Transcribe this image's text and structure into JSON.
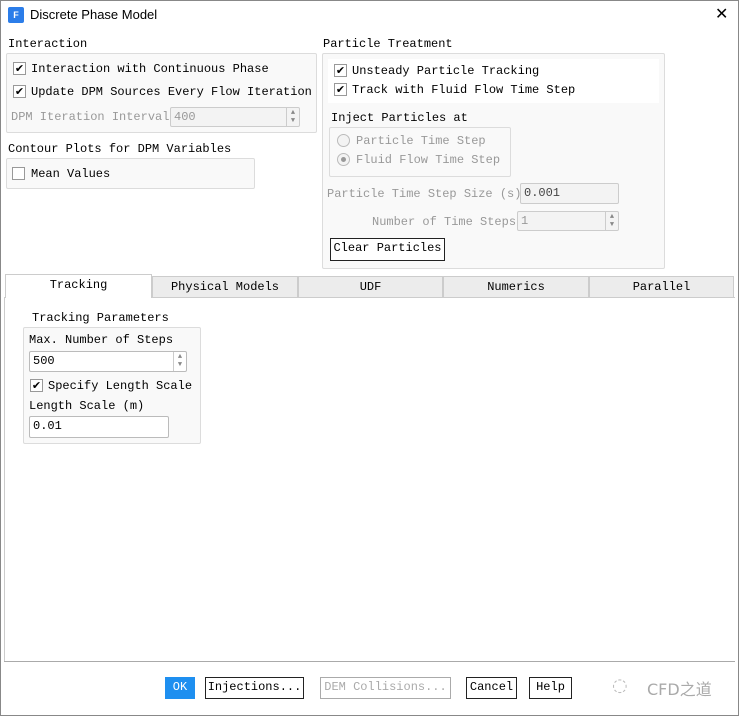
{
  "window": {
    "title": "Discrete Phase Model",
    "app_icon": "F",
    "close": "✕"
  },
  "interaction": {
    "label": "Interaction",
    "continuous_phase": {
      "label": "Interaction with Continuous Phase",
      "checked": true
    },
    "update_sources": {
      "label": "Update DPM Sources Every Flow Iteration",
      "checked": true
    },
    "iteration_interval": {
      "label": "DPM Iteration Interval",
      "value": "400"
    }
  },
  "contour": {
    "label": "Contour Plots for DPM Variables",
    "mean_values": {
      "label": "Mean Values",
      "checked": false
    }
  },
  "particle_treatment": {
    "label": "Particle Treatment",
    "unsteady": {
      "label": "Unsteady Particle Tracking",
      "checked": true
    },
    "track_fluid": {
      "label": "Track with Fluid Flow Time Step",
      "checked": true
    },
    "inject": {
      "label": "Inject Particles at",
      "options": [
        "Particle Time Step",
        "Fluid Flow Time Step"
      ],
      "selected": "Fluid Flow Time Step"
    },
    "time_step_size": {
      "label": "Particle Time Step Size (s)",
      "value": "0.001"
    },
    "num_time_steps": {
      "label": "Number of Time Steps",
      "value": "1"
    },
    "clear_button": "Clear Particles"
  },
  "tabs": [
    "Tracking",
    "Physical Models",
    "UDF",
    "Numerics",
    "Parallel"
  ],
  "active_tab": "Tracking",
  "tracking": {
    "label": "Tracking Parameters",
    "max_steps": {
      "label": "Max. Number of Steps",
      "value": "500"
    },
    "specify_length": {
      "label": "Specify Length Scale",
      "checked": true
    },
    "length_scale": {
      "label": "Length Scale (m)",
      "value": "0.01"
    }
  },
  "buttons": {
    "ok": "OK",
    "injections": "Injections...",
    "dem": "DEM Collisions...",
    "cancel": "Cancel",
    "help": "Help"
  },
  "watermark": "CFD之道",
  "colors": {
    "accent": "#1e8ff0"
  }
}
